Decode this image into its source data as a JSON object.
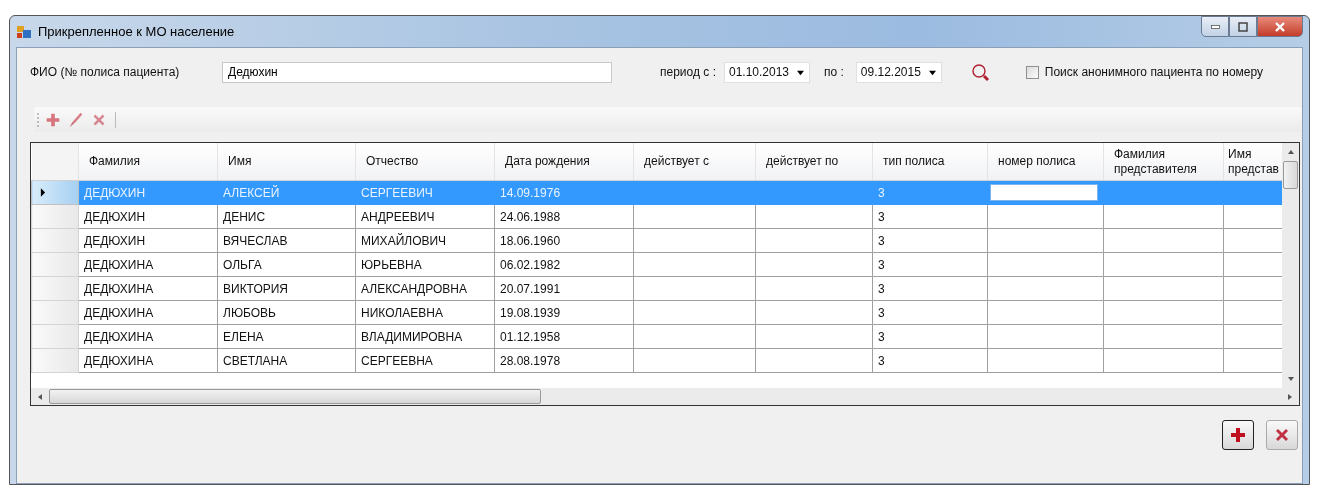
{
  "window": {
    "title": "Прикрепленное к МО население"
  },
  "filter": {
    "name_label": "ФИО (№ полиса пациента)",
    "name_value": "Дедюхин",
    "period_from_label": "период с :",
    "period_from": "01.10.2013",
    "period_to_label": "по :",
    "period_to": "09.12.2015",
    "anonymous_checkbox": {
      "label": "Поиск анонимного пациента по номеру",
      "checked": false
    }
  },
  "toolbar": {
    "buttons": [
      {
        "kind": "add",
        "disabled": true
      },
      {
        "kind": "edit",
        "disabled": true
      },
      {
        "kind": "delete",
        "disabled": true
      }
    ]
  },
  "table": {
    "columns": [
      "Фамилия",
      "Имя",
      "Отчество",
      "Дата рождения",
      "действует с",
      "действует по",
      "тип полиса",
      "номер полиса",
      "Фамилия представителя",
      "Имя представ"
    ],
    "rows": [
      {
        "selected": true,
        "editing": true,
        "cells": [
          "ДЕДЮХИН",
          "АЛЕКСЕЙ",
          "СЕРГЕЕВИЧ",
          "14.09.1976",
          "",
          "",
          "3",
          "",
          "",
          ""
        ]
      },
      {
        "selected": false,
        "editing": false,
        "cells": [
          "ДЕДЮХИН",
          "ДЕНИС",
          "АНДРЕЕВИЧ",
          "24.06.1988",
          "",
          "",
          "3",
          "",
          "",
          ""
        ]
      },
      {
        "selected": false,
        "editing": false,
        "cells": [
          "ДЕДЮХИН",
          "ВЯЧЕСЛАВ",
          "МИХАЙЛОВИЧ",
          "18.06.1960",
          "",
          "",
          "3",
          "",
          "",
          ""
        ]
      },
      {
        "selected": false,
        "editing": false,
        "cells": [
          "ДЕДЮХИНА",
          "ОЛЬГА",
          "ЮРЬЕВНА",
          "06.02.1982",
          "",
          "",
          "3",
          "",
          "",
          ""
        ]
      },
      {
        "selected": false,
        "editing": false,
        "cells": [
          "ДЕДЮХИНА",
          "ВИКТОРИЯ",
          "АЛЕКСАНДРОВНА",
          "20.07.1991",
          "",
          "",
          "3",
          "",
          "",
          ""
        ]
      },
      {
        "selected": false,
        "editing": false,
        "cells": [
          "ДЕДЮХИНА",
          "ЛЮБОВЬ",
          "НИКОЛАЕВНА",
          "19.08.1939",
          "",
          "",
          "3",
          "",
          "",
          ""
        ]
      },
      {
        "selected": false,
        "editing": false,
        "cells": [
          "ДЕДЮХИНА",
          "ЕЛЕНА",
          "ВЛАДИМИРОВНА",
          "01.12.1958",
          "",
          "",
          "3",
          "",
          "",
          ""
        ]
      },
      {
        "selected": false,
        "editing": false,
        "cells": [
          "ДЕДЮХИНА",
          "СВЕТЛАНА",
          "СЕРГЕЕВНА",
          "28.08.1978",
          "",
          "",
          "3",
          "",
          "",
          ""
        ]
      }
    ]
  },
  "actions": [
    {
      "kind": "add"
    },
    {
      "kind": "delete"
    }
  ]
}
